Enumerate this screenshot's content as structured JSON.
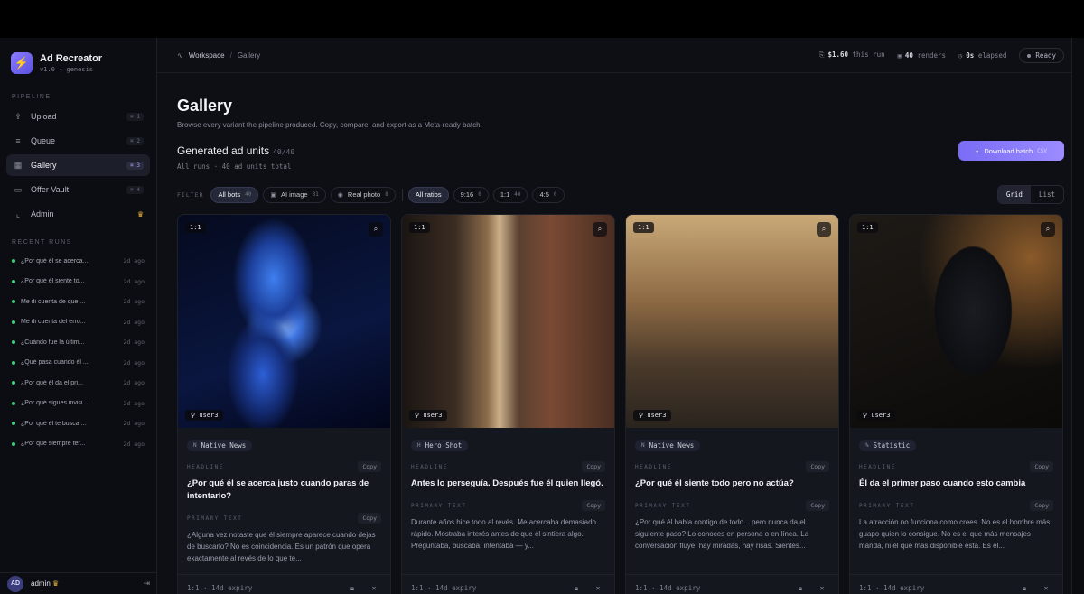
{
  "brand": {
    "name": "Ad Recreator",
    "version": "v1.0 · genesis",
    "logo_icon": "bolt-icon"
  },
  "sidebar": {
    "pipeline_label": "PIPELINE",
    "items": [
      {
        "label": "Upload",
        "icon": "upload-icon",
        "kbd": "⌘ 1"
      },
      {
        "label": "Queue",
        "icon": "queue-icon",
        "kbd": "⌘ 2"
      },
      {
        "label": "Gallery",
        "icon": "grid-icon",
        "kbd": "⌘ 3"
      },
      {
        "label": "Offer Vault",
        "icon": "vault-icon",
        "kbd": "⌘ 4"
      },
      {
        "label": "Admin",
        "icon": "chart-icon",
        "badge": "crown"
      }
    ],
    "recent_label": "RECENT RUNS",
    "runs": [
      {
        "title": "¿Por qué él se acerca...",
        "age": "2d ago"
      },
      {
        "title": "¿Por qué él siente to...",
        "age": "2d ago"
      },
      {
        "title": "Me di cuenta de que ...",
        "age": "2d ago"
      },
      {
        "title": "Me di cuenta del erro...",
        "age": "2d ago"
      },
      {
        "title": "¿Cuándo fue la últim...",
        "age": "2d ago"
      },
      {
        "title": "¿Qué pasa cuando él ...",
        "age": "2d ago"
      },
      {
        "title": "¿Por qué él da el pri...",
        "age": "2d ago"
      },
      {
        "title": "¿Por qué sigues invisi...",
        "age": "2d ago"
      },
      {
        "title": "¿Por qué él te busca ...",
        "age": "2d ago"
      },
      {
        "title": "¿Por qué siempre ter...",
        "age": "2d ago"
      }
    ],
    "user": {
      "initials": "AD",
      "name": "admin"
    }
  },
  "topbar": {
    "crumb_root": "Workspace",
    "crumb_current": "Gallery",
    "cost": "$1.60",
    "cost_suffix": "this run",
    "renders": "40",
    "renders_suffix": "renders",
    "elapsed": "0s",
    "elapsed_suffix": "elapsed",
    "status": "Ready"
  },
  "page": {
    "title": "Gallery",
    "subtitle": "Browse every variant the pipeline produced. Copy, compare, and export as a Meta-ready batch.",
    "section_title": "Generated ad units",
    "section_count": "40/40",
    "section_sub": "All runs · 40 ad units total",
    "download_label": "Download batch",
    "download_tag": "CSV"
  },
  "filters": {
    "label": "FILTER",
    "source": [
      {
        "label": "All bots",
        "count": "40",
        "active": true
      },
      {
        "label": "AI image",
        "count": "31",
        "icon": "image-icon"
      },
      {
        "label": "Real photo",
        "count": "8",
        "icon": "eye-icon"
      }
    ],
    "ratios": [
      {
        "label": "All ratios",
        "count": "",
        "active": true
      },
      {
        "label": "9:16",
        "count": "0"
      },
      {
        "label": "1:1",
        "count": "40"
      },
      {
        "label": "4:5",
        "count": "0"
      }
    ],
    "view_grid": "Grid",
    "view_list": "List"
  },
  "cards": [
    {
      "ratio": "1:1",
      "user": "user3",
      "type": "Native News",
      "type_icon": "N",
      "headline_label": "HEADLINE",
      "primary_label": "PRIMARY TEXT",
      "copy": "Copy",
      "headline": "¿Por qué él se acerca justo cuando paras de intentarlo?",
      "primary": "¿Alguna vez notaste que él siempre aparece cuando dejas de buscarlo? No es coincidencia. Es un patrón que opera exactamente al revés de lo que te...",
      "foot": "1:1 · 14d expiry"
    },
    {
      "ratio": "1:1",
      "user": "user3",
      "type": "Hero Shot",
      "type_icon": "H",
      "headline_label": "HEADLINE",
      "primary_label": "PRIMARY TEXT",
      "copy": "Copy",
      "headline": "Antes lo perseguía. Después fue él quien llegó.",
      "primary": "Durante años hice todo al revés. Me acercaba demasiado rápido. Mostraba interés antes de que él sintiera algo. Preguntaba, buscaba, intentaba — y...",
      "foot": "1:1 · 14d expiry"
    },
    {
      "ratio": "1:1",
      "user": "user3",
      "type": "Native News",
      "type_icon": "N",
      "headline_label": "HEADLINE",
      "primary_label": "PRIMARY TEXT",
      "copy": "Copy",
      "headline": "¿Por qué él siente todo pero no actúa?",
      "primary": "¿Por qué él habla contigo de todo... pero nunca da el siguiente paso? Lo conoces en persona o en línea. La conversación fluye, hay miradas, hay risas. Sientes...",
      "foot": "1:1 · 14d expiry"
    },
    {
      "ratio": "1:1",
      "user": "user3",
      "type": "Statistic",
      "type_icon": "%",
      "headline_label": "HEADLINE",
      "primary_label": "PRIMARY TEXT",
      "copy": "Copy",
      "headline": "Él da el primer paso cuando esto cambia",
      "primary": "La atracción no funciona como crees. No es el hombre más guapo quien lo consigue. No es el que más mensajes manda, ni el que más disponible está. Es el...",
      "foot": "1:1 · 14d expiry"
    }
  ]
}
